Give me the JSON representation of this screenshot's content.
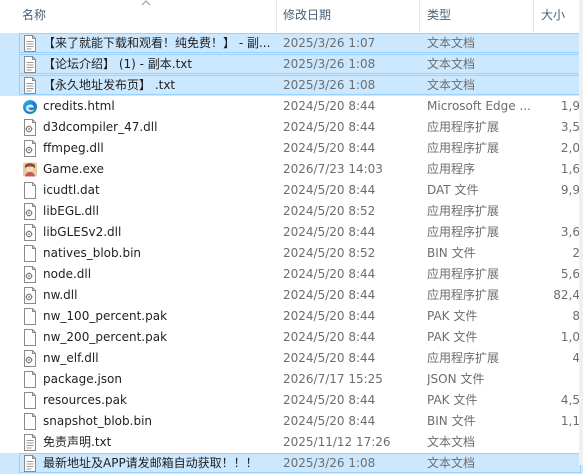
{
  "columns": {
    "name": "名称",
    "date": "修改日期",
    "type": "类型",
    "size": "大小"
  },
  "files": [
    {
      "name": "【来了就能下载和观看！纯免费！】 - 副...",
      "date": "2025/3/26 1:07",
      "type": "文本文档",
      "size": "",
      "icon": "text-file-icon",
      "selected": true
    },
    {
      "name": "【论坛介绍】 (1) - 副本.txt",
      "date": "2025/3/26 1:08",
      "type": "文本文档",
      "size": "",
      "icon": "text-file-icon",
      "selected": true
    },
    {
      "name": "【永久地址发布页】 .txt",
      "date": "2025/3/26 1:08",
      "type": "文本文档",
      "size": "",
      "icon": "text-file-icon",
      "selected": true
    },
    {
      "name": "credits.html",
      "date": "2024/5/20 8:44",
      "type": "Microsoft Edge ...",
      "size": "1,9",
      "icon": "edge-icon",
      "selected": false
    },
    {
      "name": "d3dcompiler_47.dll",
      "date": "2024/5/20 8:44",
      "type": "应用程序扩展",
      "size": "3,5",
      "icon": "dll-file-icon",
      "selected": false
    },
    {
      "name": "ffmpeg.dll",
      "date": "2024/5/20 8:44",
      "type": "应用程序扩展",
      "size": "2,0",
      "icon": "dll-file-icon",
      "selected": false
    },
    {
      "name": "Game.exe",
      "date": "2026/7/23 14:03",
      "type": "应用程序",
      "size": "1,6",
      "icon": "game-app-icon",
      "selected": false
    },
    {
      "name": "icudtl.dat",
      "date": "2024/5/20 8:44",
      "type": "DAT 文件",
      "size": "9,9",
      "icon": "blank-file-icon",
      "selected": false
    },
    {
      "name": "libEGL.dll",
      "date": "2024/5/20 8:52",
      "type": "应用程序扩展",
      "size": "",
      "icon": "dll-file-icon",
      "selected": false
    },
    {
      "name": "libGLESv2.dll",
      "date": "2024/5/20 8:44",
      "type": "应用程序扩展",
      "size": "3,6",
      "icon": "dll-file-icon",
      "selected": false
    },
    {
      "name": "natives_blob.bin",
      "date": "2024/5/20 8:52",
      "type": "BIN 文件",
      "size": "2",
      "icon": "blank-file-icon",
      "selected": false
    },
    {
      "name": "node.dll",
      "date": "2024/5/20 8:44",
      "type": "应用程序扩展",
      "size": "5,6",
      "icon": "dll-file-icon",
      "selected": false
    },
    {
      "name": "nw.dll",
      "date": "2024/5/20 8:44",
      "type": "应用程序扩展",
      "size": "82,4",
      "icon": "dll-file-icon",
      "selected": false
    },
    {
      "name": "nw_100_percent.pak",
      "date": "2024/5/20 8:44",
      "type": "PAK 文件",
      "size": "8",
      "icon": "blank-file-icon",
      "selected": false
    },
    {
      "name": "nw_200_percent.pak",
      "date": "2024/5/20 8:44",
      "type": "PAK 文件",
      "size": "1,0",
      "icon": "blank-file-icon",
      "selected": false
    },
    {
      "name": "nw_elf.dll",
      "date": "2024/5/20 8:44",
      "type": "应用程序扩展",
      "size": "4",
      "icon": "dll-file-icon",
      "selected": false
    },
    {
      "name": "package.json",
      "date": "2026/7/17 15:25",
      "type": "JSON 文件",
      "size": "",
      "icon": "blank-file-icon",
      "selected": false
    },
    {
      "name": "resources.pak",
      "date": "2024/5/20 8:44",
      "type": "PAK 文件",
      "size": "4,5",
      "icon": "blank-file-icon",
      "selected": false
    },
    {
      "name": "snapshot_blob.bin",
      "date": "2024/5/20 8:44",
      "type": "BIN 文件",
      "size": "1,1",
      "icon": "blank-file-icon",
      "selected": false
    },
    {
      "name": "免责声明.txt",
      "date": "2025/11/12 17:26",
      "type": "文本文档",
      "size": "",
      "icon": "text-file-icon",
      "selected": false
    },
    {
      "name": "最新地址及APP请发邮箱自动获取！！！",
      "date": "2025/3/26 1:08",
      "type": "文本文档",
      "size": "",
      "icon": "text-file-icon",
      "selected": true
    }
  ],
  "colors": {
    "selection": "#cce8ff",
    "selection_border": "#99d1ff",
    "header_text": "#4c607a",
    "secondary_text": "#6d6d6d"
  }
}
